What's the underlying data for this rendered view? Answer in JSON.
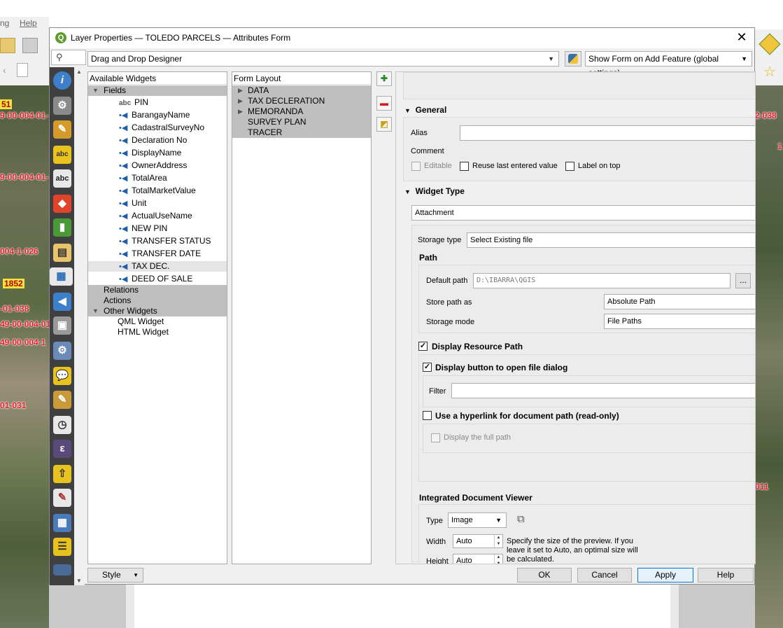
{
  "bg": {
    "menu": [
      "ng",
      "Help"
    ],
    "map_labels_left": [
      "51",
      "9-00-004-01-",
      "9-00-004-01-",
      "004-1-026",
      "1852",
      "-01-038",
      "49-00-004-01",
      "49-00-004-1",
      "01-031"
    ],
    "map_labels_right": [
      "2-038",
      "1",
      "011"
    ]
  },
  "dialog": {
    "title": "Layer Properties — TOLEDO PARCELS — Attributes Form",
    "close": "✕",
    "search_icon": "⚲",
    "designer_mode": "Drag and Drop Designer",
    "show_form": "Show Form on Add Feature (global settings)"
  },
  "available": {
    "header": "Available Widgets",
    "fields_label": "Fields",
    "fields": [
      "PIN",
      "BarangayName",
      "CadastralSurveyNo",
      "Declaration No",
      "DisplayName",
      "OwnerAddress",
      "TotalArea",
      "TotalMarketValue",
      "Unit",
      "ActualUseName",
      "NEW PIN",
      "TRANSFER STATUS",
      "TRANSFER DATE",
      "TAX DEC.",
      "DEED OF SALE"
    ],
    "pin_type": "abc",
    "relations": "Relations",
    "actions": "Actions",
    "other": "Other Widgets",
    "other_items": [
      "QML Widget",
      "HTML Widget"
    ]
  },
  "form_layout": {
    "header": "Form Layout",
    "items": [
      "DATA",
      "TAX DECLERATION",
      "MEMORANDA",
      "SURVEY PLAN",
      "TRACER"
    ]
  },
  "config": {
    "general": "General",
    "alias_label": "Alias",
    "alias_value": "",
    "comment_label": "Comment",
    "editable": "Editable",
    "reuse": "Reuse last entered value",
    "label_on_top": "Label on top",
    "widget_type_hdr": "Widget Type",
    "widget_type": "Attachment",
    "storage_type_label": "Storage type",
    "storage_type": "Select Existing file",
    "path_hdr": "Path",
    "default_path_label": "Default path",
    "default_path": "D:\\IBARRA\\QGIS",
    "browse": "...",
    "store_path_label": "Store path as",
    "store_path": "Absolute Path",
    "storage_mode_label": "Storage mode",
    "storage_mode": "File Paths",
    "display_resource_path": "Display Resource Path",
    "display_button": "Display button to open file dialog",
    "filter_label": "Filter",
    "filter_value": "",
    "use_hyperlink": "Use a hyperlink for document path (read-only)",
    "display_full_path": "Display the full path",
    "viewer_hdr": "Integrated Document Viewer",
    "type_label": "Type",
    "type_value": "Image",
    "width_label": "Width",
    "width_value": "Auto",
    "height_label": "Height",
    "height_value": "Auto",
    "size_hint": "Specify the size of the preview. If you leave it set to Auto, an optimal size will be calculated."
  },
  "buttons": {
    "style": "Style",
    "ok": "OK",
    "cancel": "Cancel",
    "apply": "Apply",
    "help": "Help"
  }
}
